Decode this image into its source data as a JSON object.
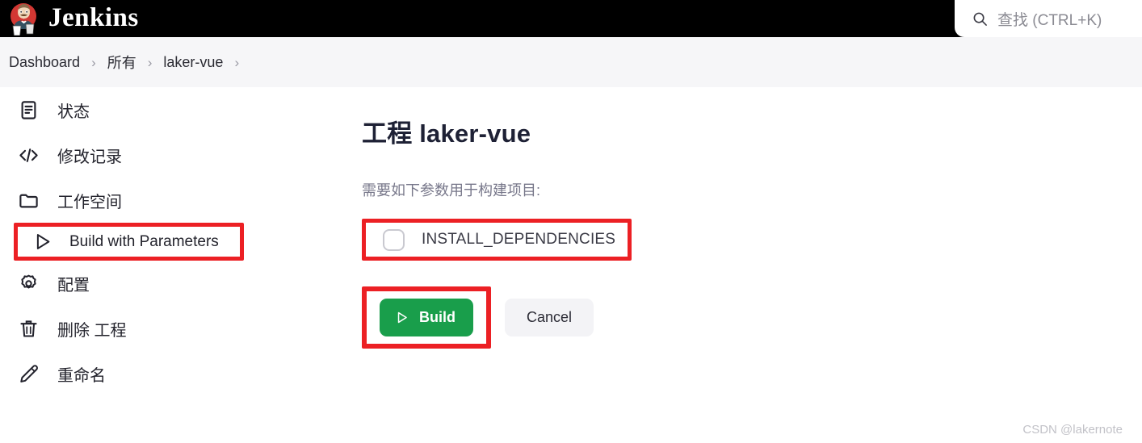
{
  "header": {
    "brand_title": "Jenkins",
    "logo_icon": "jenkins-butler-logo",
    "search": {
      "icon": "search-icon",
      "placeholder": "查找 (CTRL+K)"
    }
  },
  "breadcrumb": {
    "separator": "›",
    "items": [
      {
        "label": "Dashboard"
      },
      {
        "label": "所有"
      },
      {
        "label": "laker-vue"
      }
    ],
    "trailing_separator": "›"
  },
  "sidebar": {
    "items": [
      {
        "label": "状态",
        "icon": "document-icon",
        "highlighted": false
      },
      {
        "label": "修改记录",
        "icon": "code-icon",
        "highlighted": false
      },
      {
        "label": "工作空间",
        "icon": "folder-icon",
        "highlighted": false
      },
      {
        "label": "Build with Parameters",
        "icon": "play-icon",
        "highlighted": true
      },
      {
        "label": "配置",
        "icon": "gear-icon",
        "highlighted": false
      },
      {
        "label": "删除 工程",
        "icon": "trash-icon",
        "highlighted": false
      },
      {
        "label": "重命名",
        "icon": "pencil-icon",
        "highlighted": false
      }
    ]
  },
  "main": {
    "title": "工程 laker-vue",
    "note": "需要如下参数用于构建项目:",
    "parameters": [
      {
        "name": "INSTALL_DEPENDENCIES",
        "type": "checkbox",
        "checked": false
      }
    ],
    "build_button": {
      "label": "Build",
      "icon": "play-icon"
    },
    "cancel_button": {
      "label": "Cancel"
    }
  },
  "watermark": "CSDN @lakernote",
  "colors": {
    "header_bg": "#000000",
    "breadcrumb_bg": "#f6f6f8",
    "accent_red": "#ec2024",
    "build_green": "#199e4b",
    "cancel_gray": "#f3f3f6",
    "title_navy": "#1e2135"
  }
}
